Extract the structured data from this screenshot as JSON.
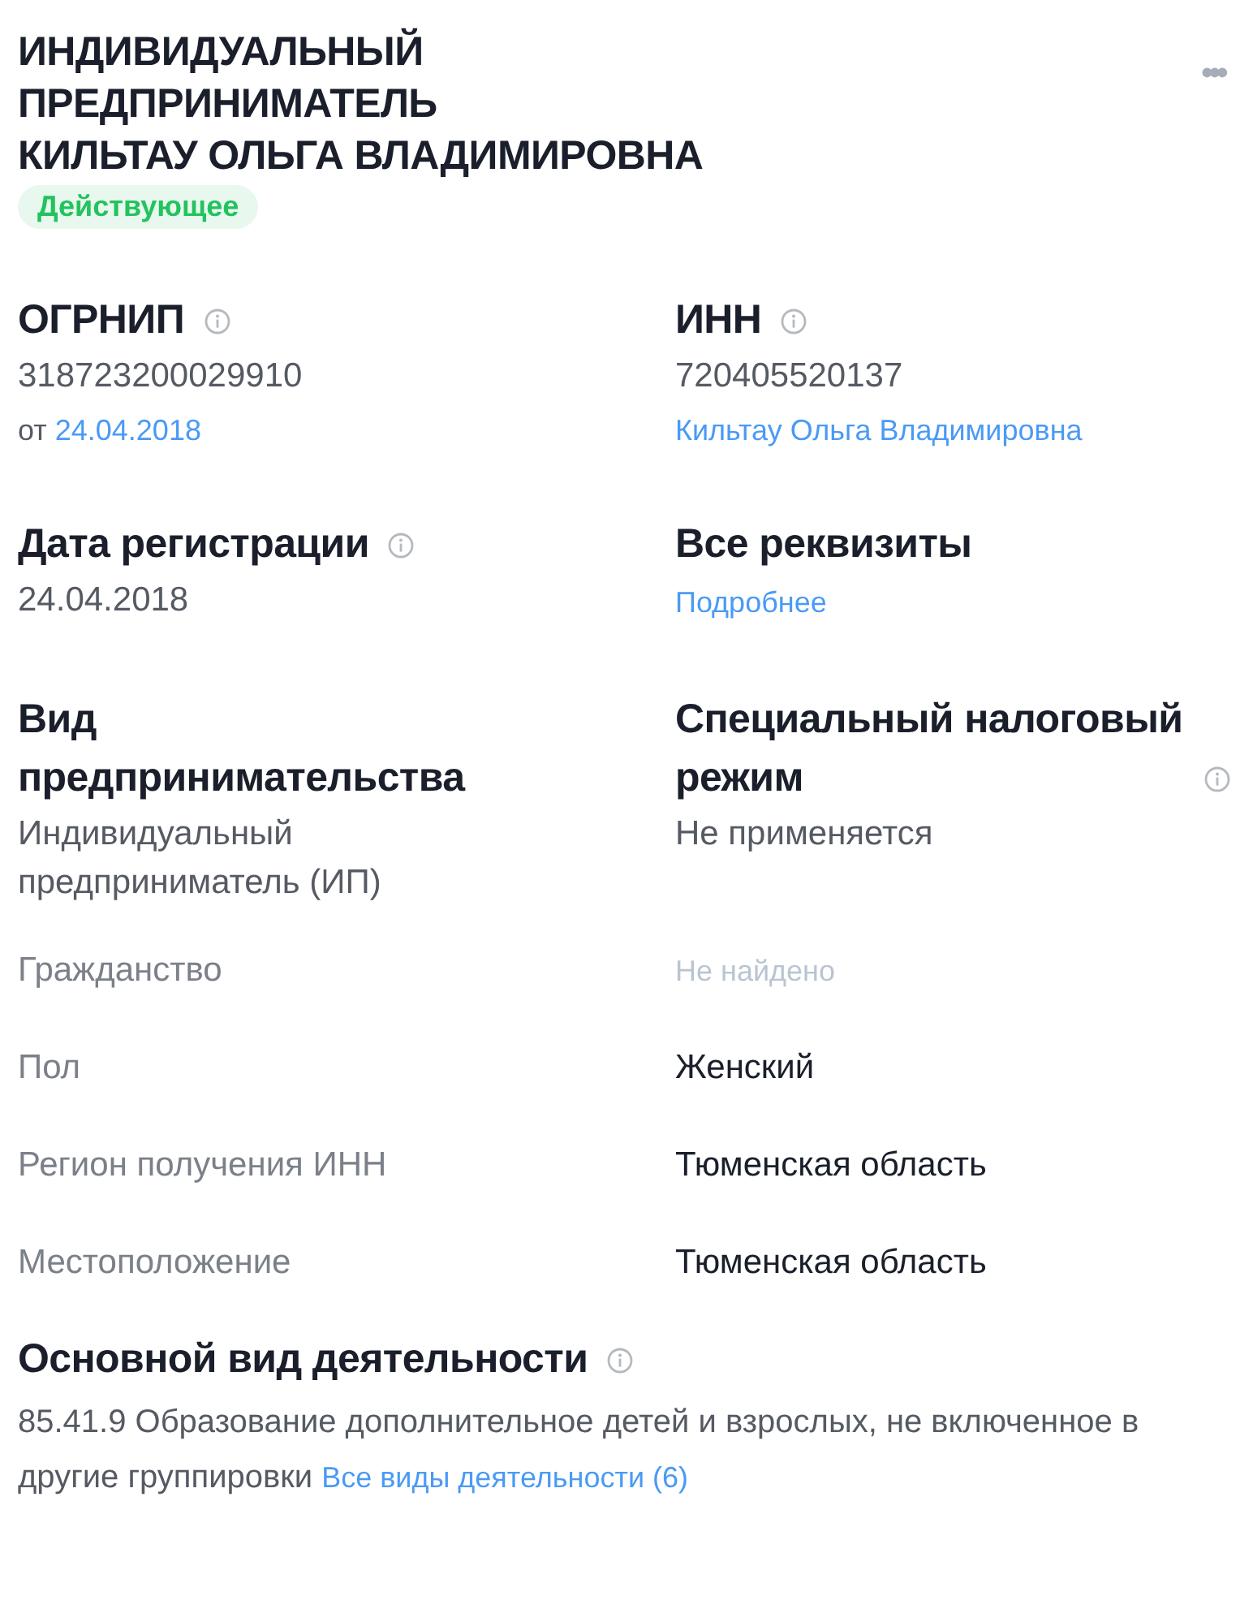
{
  "header": {
    "title_lines": [
      "ИНДИВИДУАЛЬНЫЙ",
      "ПРЕДПРИНИМАТЕЛЬ",
      "КИЛЬТАУ ОЛЬГА ВЛАДИМИРОВНА"
    ],
    "status": {
      "label": "Действующее",
      "kind": "active"
    },
    "menu_icon": "•••"
  },
  "blocks": [
    {
      "title": "ОГРНИП",
      "info": true,
      "value": "318723200029910",
      "prefix": "от",
      "link": "24.04.2018"
    },
    {
      "title": "ИНН",
      "info": true,
      "value": "720405520137",
      "link": "Кильтау Ольга Владимировна"
    },
    {
      "title": "Дата регистрации",
      "info": true,
      "value": "24.04.2018"
    },
    {
      "title": "Все реквизиты",
      "info": false,
      "link": "Подробнее"
    },
    {
      "title": "Вид предпринимательства",
      "info": false,
      "value": "Индивидуальный предприниматель (ИП)"
    },
    {
      "title": "Специальный налоговый режим",
      "info": true,
      "value": "Не применяется"
    }
  ],
  "properties": [
    {
      "label": "Гражданство",
      "value": "Не найдено",
      "found": false
    },
    {
      "label": "Пол",
      "value": "Женский",
      "found": true
    },
    {
      "label": "Регион получения ИНН",
      "value": "Тюменская область",
      "found": true
    },
    {
      "label": "Местоположение",
      "value": "Тюменская область",
      "found": true
    }
  ],
  "activity": {
    "title": "Основной вид деятельности",
    "info": true,
    "text": "85.41.9 Образование дополнительное детей и взрослых, не включенное в другие группировки",
    "link": "Все виды деятельности (6)"
  }
}
